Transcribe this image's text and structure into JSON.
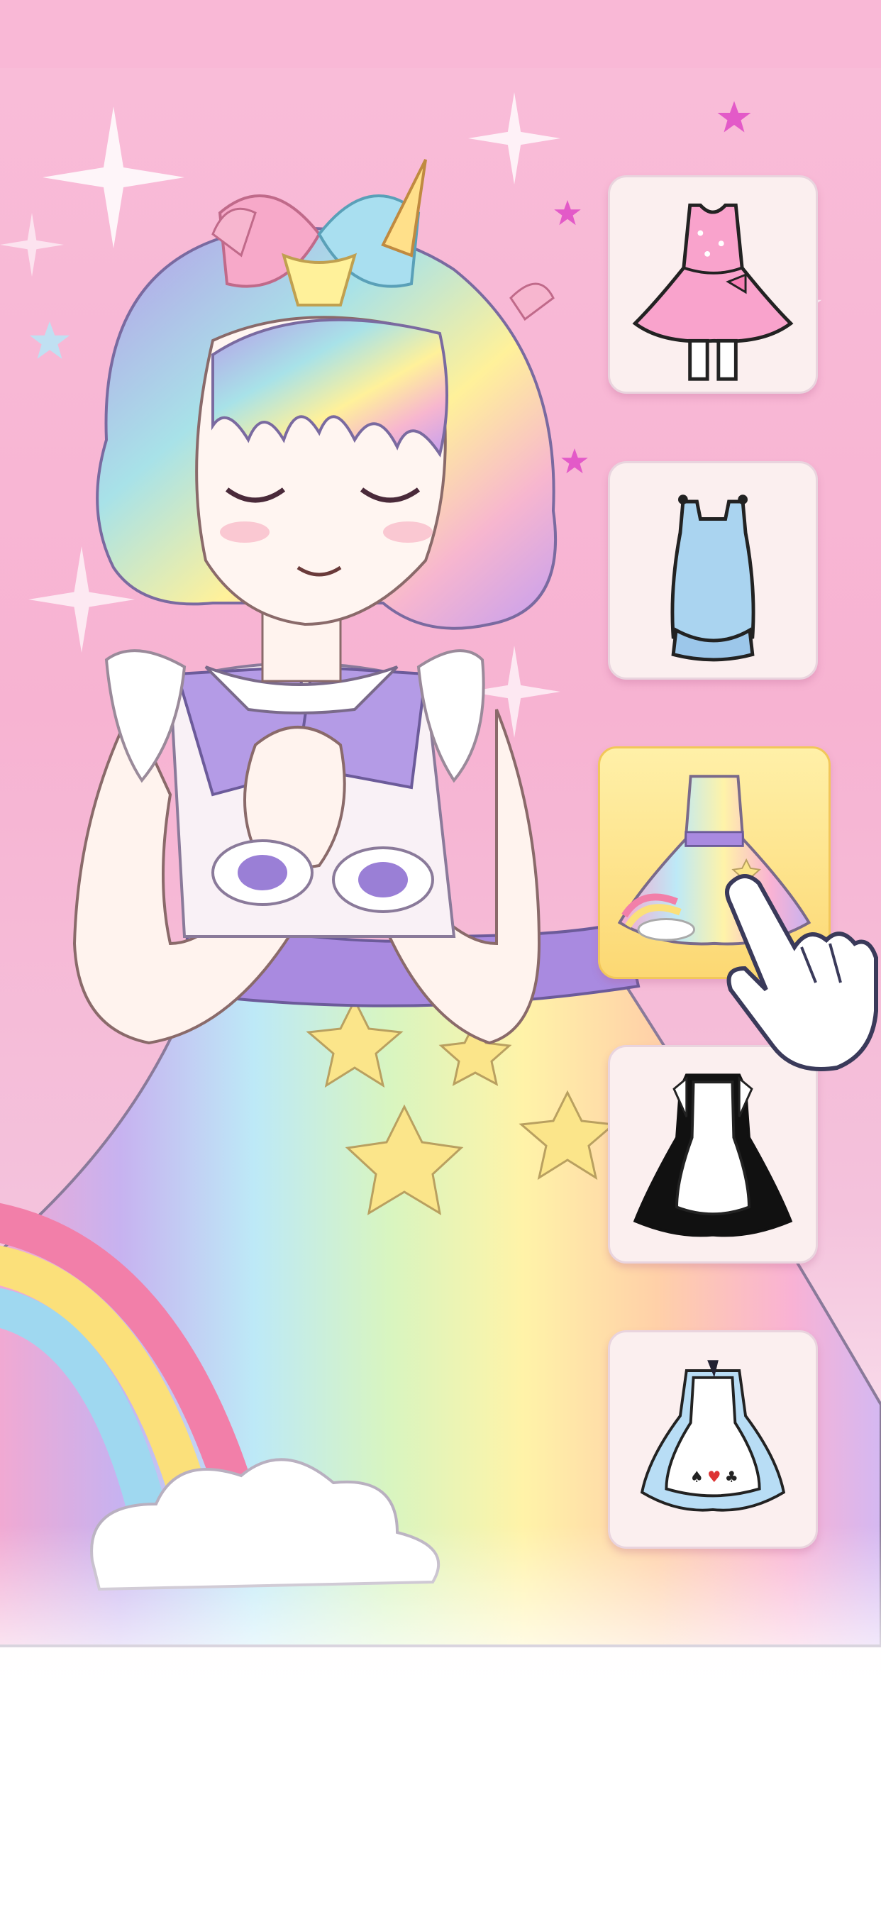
{
  "theme": {
    "background_pink": "#f7b3d2",
    "card_bg": "#fbefef",
    "card_selected_bg": "#fcd873"
  },
  "character": {
    "icon": "anime-girl-character",
    "hair": "pastel-rainbow-bob",
    "accessory": "unicorn-rainbow-bow",
    "outfit": "rainbow-star-dress"
  },
  "outfit_picker": {
    "selected_index": 2,
    "items": [
      {
        "icon": "pink-polka-dot-dress-icon"
      },
      {
        "icon": "blue-nightgown-icon"
      },
      {
        "icon": "rainbow-dress-icon"
      },
      {
        "icon": "maid-dress-icon"
      },
      {
        "icon": "card-suit-apron-dress-icon"
      }
    ]
  },
  "tutorial_hint": {
    "icon": "pointing-hand-icon"
  }
}
